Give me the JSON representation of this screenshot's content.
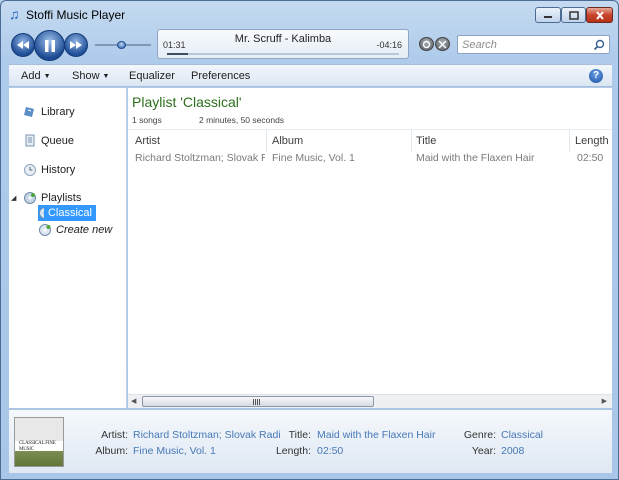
{
  "window": {
    "title": "Stoffi Music Player",
    "icon": "music-note-icon",
    "controls": [
      "minimize-icon",
      "maximize-icon",
      "close-icon"
    ]
  },
  "player": {
    "prev_icon": "previous-icon",
    "play_icon": "pause-icon",
    "next_icon": "next-icon",
    "volume": 0.5,
    "now_playing": "Mr. Scruff - Kalimba",
    "elapsed": "01:31",
    "remaining": "-04:16",
    "progress": 0.09,
    "shuffle_icon": "shuffle-icon",
    "repeat_icon": "repeat-icon"
  },
  "search": {
    "placeholder": "Search",
    "icon": "search-icon"
  },
  "menu": {
    "add": "Add",
    "show": "Show",
    "equalizer": "Equalizer",
    "preferences": "Preferences",
    "help_icon": "help-icon",
    "help_glyph": "?"
  },
  "sidebar": {
    "library": "Library",
    "queue": "Queue",
    "history": "History",
    "playlists": "Playlists",
    "playlist_items": [
      "Classical"
    ],
    "create_new": "Create new"
  },
  "playlist": {
    "heading": "Playlist 'Classical'",
    "song_count": "1 songs",
    "duration": "2 minutes, 50 seconds",
    "columns": {
      "artist": "Artist",
      "album": "Album",
      "title": "Title",
      "length": "Length"
    },
    "rows": [
      {
        "artist": "Richard Stoltzman; Slovak R...",
        "album": "Fine Music, Vol. 1",
        "title": "Maid with the Flaxen Hair",
        "length": "02:50"
      }
    ]
  },
  "scrollbar": {
    "grip": "III"
  },
  "details": {
    "art_text": "CLASSICAL FINE MUSIC",
    "artist_label": "Artist:",
    "artist": "Richard Stoltzman; Slovak Radio...",
    "album_label": "Album:",
    "album": "Fine Music, Vol. 1",
    "title_label": "Title:",
    "title": "Maid with the Flaxen Hair",
    "length_label": "Length:",
    "length": "02:50",
    "genre_label": "Genre:",
    "genre": "Classical",
    "year_label": "Year:",
    "year": "2008"
  }
}
